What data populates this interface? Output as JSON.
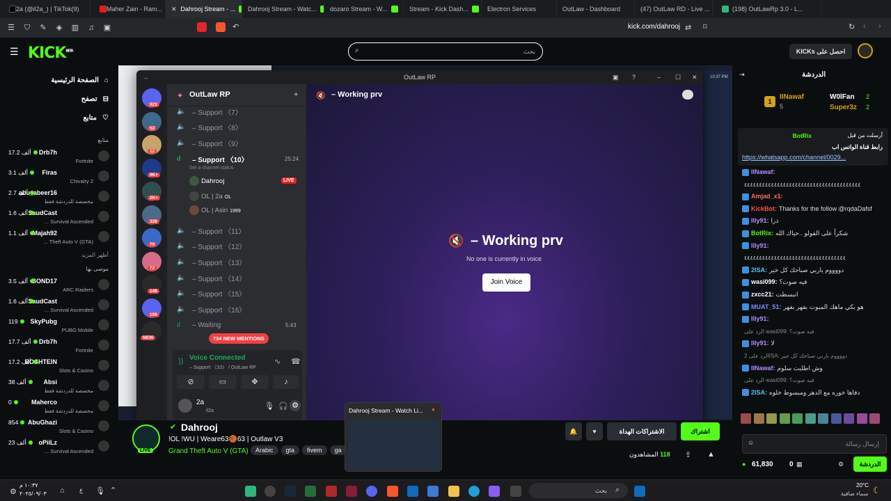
{
  "browser": {
    "tabs": [
      {
        "label": "2a (@il2a_) | TikTok",
        "count": "(9)"
      },
      {
        "label": "Maher Zain - Ram..."
      },
      {
        "label": "Dahrooj Stream - ...",
        "active": true
      },
      {
        "label": "Dahrooj Stream - Watc..."
      },
      {
        "label": "dozaro Stream - W..."
      },
      {
        "label": "Stream - Kick Dash..."
      },
      {
        "label": "Electron Services"
      },
      {
        "label": "OutLaw - Dashboard"
      },
      {
        "label": "(47) OutLaw RD - Live ..."
      },
      {
        "label": "(198) OutLawRp 3.0 - L..."
      }
    ],
    "url": "kick.com/dahrooj"
  },
  "kick": {
    "logo": "KICK",
    "logo_sup": "BETA",
    "search_placeholder": "بحث",
    "get_kicks": "احصل على KICKs",
    "nav": [
      {
        "label": "الصفحة الرئيسية",
        "icon": "home-icon"
      },
      {
        "label": "تصفح",
        "icon": "browse-icon"
      },
      {
        "label": "متابع",
        "icon": "heart-icon"
      }
    ],
    "following_header": "متابع",
    "following": [
      {
        "name": "Drb7h",
        "game": "Fortnite",
        "viewers": "17.2 ألف"
      },
      {
        "name": "Firas",
        "game": "Chivalry 2",
        "viewers": "3.1 ألف"
      },
      {
        "name": "abu_abeer16",
        "game": "مخصصة للدردشة فقط",
        "viewers": "2.7 ألف"
      },
      {
        "name": "SaudCast",
        "game": "Survival Ascended ...",
        "viewers": "1.6 ألف"
      },
      {
        "name": "Majah92",
        "game": "Theft Auto V (GTA) ...",
        "viewers": "1.1 ألف"
      }
    ],
    "show_more": "أظهر المزيد",
    "recommended_header": "موصى بها",
    "recommended": [
      {
        "name": "BOND17",
        "game": "ARC Raiders",
        "viewers": "3.5 ألف"
      },
      {
        "name": "SaudCast",
        "game": "Survival Ascended ...",
        "viewers": "1.6 ألف"
      },
      {
        "name": "SkyPubg",
        "game": "PUBG Mobile",
        "viewers": "119"
      },
      {
        "name": "Drb7h",
        "game": "Fortnite",
        "viewers": "17.7 ألف"
      },
      {
        "name": "ROSHTEIN",
        "game": "Slots & Casino",
        "viewers": "17.2 ألف"
      },
      {
        "name": "Absi",
        "game": "مخصصة للدردشة فقط",
        "viewers": "38 ألف"
      },
      {
        "name": "Maherco",
        "game": "مخصصة للدردشة فقط",
        "viewers": "0"
      },
      {
        "name": "AbuGhazi",
        "game": "Slots & Casino",
        "viewers": "854"
      },
      {
        "name": "oPiiLz",
        "game": "Survival Ascended ...",
        "viewers": "23 ألف"
      }
    ]
  },
  "discord": {
    "window_title": "OutLaw RP",
    "server_name": "OutLaw RP",
    "server_badges": [
      "923",
      "52",
      "12",
      "9K+",
      "2K+",
      "328",
      "79",
      "72",
      "148",
      "189",
      "NEW"
    ],
    "channels": [
      {
        "name": "– Support 〈7〉"
      },
      {
        "name": "– Support 〈8〉"
      },
      {
        "name": "– Support 〈9〉"
      }
    ],
    "active_channel": {
      "name": "– Support 〈10〉",
      "time": "25:24",
      "status": "Set a channel status"
    },
    "voice_users": [
      {
        "name": "Dahrooj",
        "badge": "LIVE"
      },
      {
        "name": "OL | 2a",
        "tag": "OL"
      },
      {
        "name": "OL | Asiri",
        "tag": "1999"
      }
    ],
    "channels_after": [
      {
        "name": "– Support 〈11〉"
      },
      {
        "name": "– Support 〈12〉"
      },
      {
        "name": "– Support 〈13〉"
      },
      {
        "name": "– Support 〈14〉"
      },
      {
        "name": "– Support 〈15〉"
      },
      {
        "name": "– Support 〈16〉"
      }
    ],
    "waiting_channel": {
      "name": "– Waiting",
      "time": "5:43"
    },
    "mentions": "734 NEW MENTIONS",
    "voice_connected": "Voice Connected",
    "voice_location": "– Support 〈10〉 / OutLaw RP",
    "user": {
      "name": "2a",
      "tag": "il2a"
    },
    "header_channel": "– Working prv",
    "center_title": "– Working prv",
    "center_subtitle": "No one is currently in voice",
    "join_button": "Join Voice"
  },
  "chat": {
    "title": "الدردشة",
    "top": [
      {
        "name": "IINawaf",
        "value": "5",
        "rank": "1"
      },
      {
        "name": "W0lFan",
        "value": "2"
      },
      {
        "name": "Super3z",
        "value": "2"
      }
    ],
    "pinned": {
      "by": "أرسلت من قبل",
      "user": "BotRix",
      "text": "رابط قناة الواتس اب",
      "link": "https://whatsapp.com/channel/0029..."
    },
    "messages": [
      {
        "user": "IINawaf:",
        "text": "",
        "color": "#b48cff"
      },
      {
        "user": "",
        "text": "٤٤٤٤٤٤٤٤٤٤٤٤٤٤٤٤٤٤٤٤٤٤٤٤٤٤٤٤٤٤٤٤٤٤٤٤٤٤٤",
        "color": "#ddd"
      },
      {
        "user": "Amjad_x1:",
        "text": "",
        "color": "#ff6b6b"
      },
      {
        "user": "KickBot:",
        "text": "Thanks for the follow @rqdaDafsf",
        "color": "#ff4d4d"
      },
      {
        "user": "Illy91:",
        "text": "ذرا",
        "color": "#b48cff"
      },
      {
        "user": "BotRix:",
        "text": "شكراً على الفولو ..حياك الله",
        "color": "#53fc18"
      },
      {
        "user": "Illy91:",
        "text": "",
        "color": "#b48cff"
      },
      {
        "user": "",
        "text": "٤٤٤٤٤٤٤٤٤٤٤٤٤٤٤٤٤٤٤٤٤٤٤٤٤٤٤٤٤٤٤٤٤٤",
        "color": "#ddd"
      },
      {
        "user": "2ISA:",
        "text": "دووووم ياربي صباحك كل خير",
        "color": "#4fc3f7"
      },
      {
        "user": "wasi099:",
        "text": "فيه صوت؟",
        "color": "#fff"
      },
      {
        "user": "zxcc21:",
        "text": "انبسطت",
        "color": "#fff"
      },
      {
        "user": "MUAT_51:",
        "text": "هو بكي ماهك المبوت بفهر بفهر",
        "color": "#7d8cff"
      },
      {
        "user": "Illy91:",
        "text": "",
        "color": "#b48cff"
      },
      {
        "user": "",
        "text": "الرد على wasi099: فيه صوت؟",
        "color": "#888"
      },
      {
        "user": "Illy91:",
        "text": "لا",
        "color": "#b48cff"
      },
      {
        "user": "",
        "text": "الرد على 2ISA: دووووم ياربي صباحك كل خير",
        "color": "#888"
      },
      {
        "user": "IINawaf:",
        "text": "وش اطلبت سلوم",
        "color": "#b48cff"
      },
      {
        "user": "",
        "text": "الرد على wasi099: فيه صوت؟",
        "color": "#888"
      },
      {
        "user": "2ISA:",
        "text": "دفاها خوره مع الدهر ومبسوط خلوه",
        "color": "#4fc3f7"
      }
    ],
    "input_placeholder": "إرسال رسالة",
    "send_button": "الدردشة",
    "kicks_count": "61,830",
    "zero": "0"
  },
  "stream": {
    "streamer": "Dahrooj",
    "title": "!OL !WU | Weare63🏀63 | Outlaw V3",
    "game": "Grand Theft Auto V (GTA)",
    "tags": [
      "Arabic",
      "gta",
      "fivem",
      "ga"
    ],
    "live_badge": "LIVE",
    "viewers": "118",
    "viewers_label": "المشاهدون",
    "subscribe": "اشتراك",
    "gift": "الاشتراكات الهداة",
    "preview_title": "Dahrooj Stream - Watch Li...",
    "overlay_time": "10:37 PM"
  },
  "taskbar": {
    "time": "١٠:٣٧ م",
    "date": "٢٠٢٥/٠٩/٠٣",
    "search": "بحث",
    "weather_temp": "20°C",
    "weather_label": "سماء صافية",
    "lang": "ع"
  },
  "colors": {
    "kick_green": "#53fc18",
    "discord_bg": "#313338",
    "live_red": "#e5242b",
    "mention_red": "#f23f43"
  }
}
